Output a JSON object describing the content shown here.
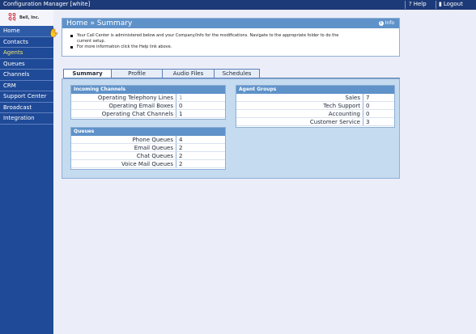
{
  "topbar": {
    "title": "Configuration Manager [white]",
    "help_label": "Help",
    "logout_label": "Logout"
  },
  "logo": {
    "mark": [
      "Q",
      "Q",
      "Q",
      "Q"
    ],
    "text": "Bell, Inc."
  },
  "sidebar": {
    "items": [
      {
        "label": "Home"
      },
      {
        "label": "Contacts"
      },
      {
        "label": "Agents"
      },
      {
        "label": "Queues"
      },
      {
        "label": "Channels"
      },
      {
        "label": "CRM"
      },
      {
        "label": "Support Center"
      },
      {
        "label": "Broadcast"
      },
      {
        "label": "Integration"
      }
    ]
  },
  "header": {
    "title": "Home » Summary",
    "info_label": "Info"
  },
  "intro": {
    "line1": "Your Call Center is administered below and your Company/Info for the modifications. Navigate to the appropriate folder to do the",
    "line1b": "current setup.",
    "line2": "For more information click the Help link above."
  },
  "tabs": [
    {
      "label": "Summary"
    },
    {
      "label": "Profile"
    },
    {
      "label": "Audio Files"
    },
    {
      "label": "Schedules"
    }
  ],
  "incoming": {
    "title": "Incoming Channels",
    "rows": [
      {
        "label": "Operating Telephony Lines",
        "value": "1"
      },
      {
        "label": "Operating Email Boxes",
        "value": "0"
      },
      {
        "label": "Operating Chat Channels",
        "value": "1"
      }
    ]
  },
  "queues": {
    "title": "Queues",
    "rows": [
      {
        "label": "Phone Queues",
        "value": "4"
      },
      {
        "label": "Email Queues",
        "value": "2"
      },
      {
        "label": "Chat Queues",
        "value": "2"
      },
      {
        "label": "Voice Mail Queues",
        "value": "2"
      }
    ]
  },
  "agent_groups": {
    "title": "Agent Groups",
    "rows": [
      {
        "label": "Sales",
        "value": "7"
      },
      {
        "label": "Tech Support",
        "value": "0"
      },
      {
        "label": "Accounting",
        "value": "0"
      },
      {
        "label": "Customer Service",
        "value": "3"
      }
    ]
  },
  "colors": {
    "topbar": "#1d3a78",
    "sidebar": "#1f4a97",
    "panel_header": "#5f92c9",
    "content_bg": "#c5dbef",
    "highlight_nav": "#f2e46a"
  }
}
